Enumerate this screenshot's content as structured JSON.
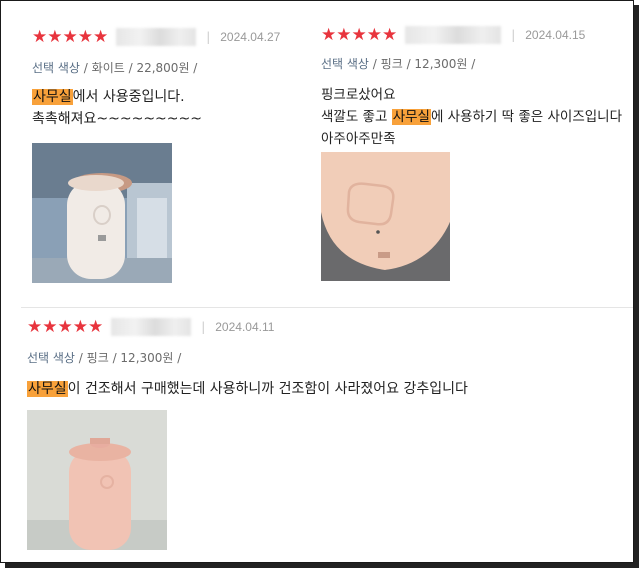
{
  "reviews": [
    {
      "stars": "★★★★★",
      "date": "2024.04.27",
      "option_label": "선택 색상",
      "option_color": "화이트",
      "option_price": "22,800원",
      "text_highlight": "사무실",
      "text_line1_rest": "에서 사용중입니다.",
      "text_line2": "촉촉해져요~~~~~~~~~"
    },
    {
      "stars": "★★★★★",
      "date": "2024.04.15",
      "option_label": "선택 색상",
      "option_color": "핑크",
      "option_price": "12,300원",
      "text_line1": "핑크로샀어요",
      "text_line2_pre": "색깔도 좋고 ",
      "text_highlight": "사무실",
      "text_line2_post": "에 사용하기 딱 좋은 사이즈입니다",
      "text_line3": "아주아주만족"
    },
    {
      "stars": "★★★★★",
      "date": "2024.04.11",
      "option_label": "선택 색상",
      "option_color": "핑크",
      "option_price": "12,300원",
      "text_highlight": "사무실",
      "text_line1_rest": "이 건조해서 구매했는데 사용하니까 건조함이 사라졌어요 강추입니다"
    }
  ],
  "colors": {
    "star": "#e8343d",
    "highlight": "#f8a13a",
    "option_label": "#5a6f86"
  }
}
